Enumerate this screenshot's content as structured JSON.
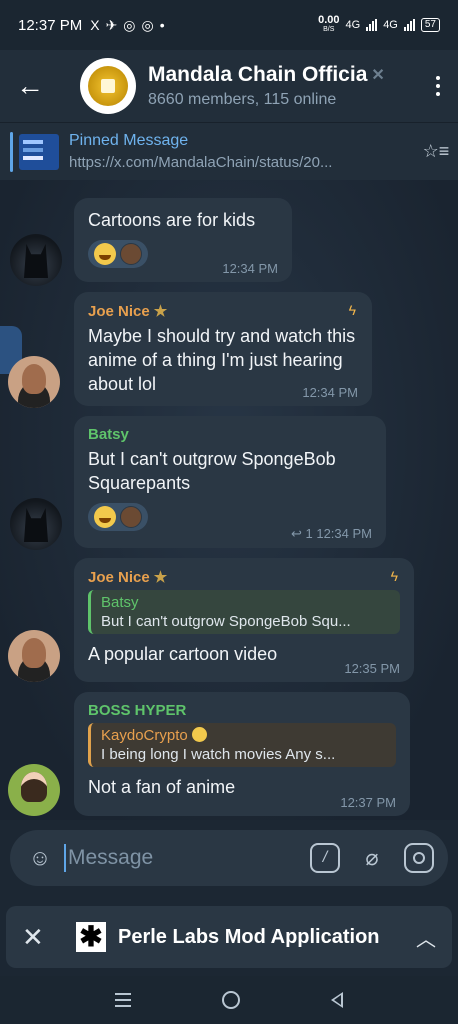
{
  "status_bar": {
    "time": "12:37 PM",
    "notif_icons": [
      "X",
      "✈",
      "◎",
      "◎",
      "•"
    ],
    "net_speed": "0.00",
    "net_unit": "B/S",
    "net_type_1": "4G",
    "net_type_2": "4G",
    "battery": "57"
  },
  "header": {
    "title": "Mandala Chain Officia",
    "subtitle": "8660 members, 115 online"
  },
  "pinned": {
    "title": "Pinned Message",
    "url": "https://x.com/MandalaChain/status/20..."
  },
  "messages": [
    {
      "text": "Cartoons are for kids",
      "time": "12:34 PM"
    },
    {
      "sender": "Joe Nice",
      "sender_color": "#e8a04e",
      "text": "Maybe I should try and watch this anime of a thing I'm just hearing about lol",
      "time": "12:34 PM"
    },
    {
      "sender": "Batsy",
      "sender_color": "#5fc46b",
      "text": "But I can't outgrow SpongeBob Squarepants",
      "time": "12:34 PM",
      "reply_count": "1"
    },
    {
      "sender": "Joe Nice",
      "sender_color": "#e8a04e",
      "reply_name": "Batsy",
      "reply_text": "But I can't outgrow SpongeBob Squ...",
      "text": "A popular cartoon video",
      "time": "12:35 PM"
    },
    {
      "sender": "BOSS HYPER",
      "sender_color": "#5fc46b",
      "reply_name": "KaydoCrypto",
      "reply_text": "I being long I watch movies   Any s...",
      "text": "Not a fan of anime",
      "time": "12:37 PM"
    }
  ],
  "composer": {
    "placeholder": "Message",
    "slash_label": "/"
  },
  "mini_app": {
    "name": "Perle Labs Mod Application",
    "logo": "✱"
  }
}
